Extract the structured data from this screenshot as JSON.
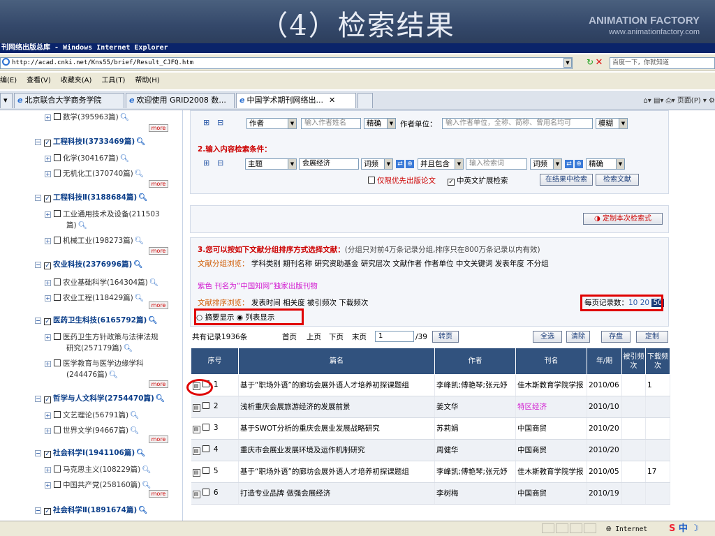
{
  "slide_title": "（4）检索结果",
  "brand": {
    "name": "ANIMATION FACTORY",
    "url": "www.animationfactory.com"
  },
  "window_title": "刊网络出版总库 - Windows Internet Explorer",
  "address": "http://acad.cnki.net/Kns55/brief/Result_CJFQ.htm",
  "search_placeholder": "百度一下，你就知道",
  "menu": [
    "编(E)",
    "查看(V)",
    "收藏夹(A)",
    "工具(T)",
    "帮助(H)"
  ],
  "tabs": [
    "北京联合大学商务学院",
    "欢迎使用 GRID2008 数...",
    "中国学术期刊网络出..."
  ],
  "tab_tools": "页面(P)",
  "sidebar": {
    "items": [
      {
        "text": "数学(395963篇)",
        "level": "sub"
      },
      {
        "text": "工程科技Ⅰ(3733469篇)",
        "level": "top"
      },
      {
        "text": "化学(304167篇)",
        "level": "sub"
      },
      {
        "text": "无机化工(370740篇)",
        "level": "sub"
      },
      {
        "text": "工程科技Ⅱ(3188684篇)",
        "level": "top"
      },
      {
        "text": "工业通用技术及设备(211503",
        "level": "sub"
      },
      {
        "text": "篇)",
        "level": "cont"
      },
      {
        "text": "机械工业(198273篇)",
        "level": "sub"
      },
      {
        "text": "农业科技(2376996篇)",
        "level": "top"
      },
      {
        "text": "农业基础科学(164304篇)",
        "level": "sub"
      },
      {
        "text": "农业工程(118429篇)",
        "level": "sub"
      },
      {
        "text": "医药卫生科技(6165792篇)",
        "level": "top"
      },
      {
        "text": "医药卫生方针政策与法律法规",
        "level": "sub"
      },
      {
        "text": "研究(257179篇)",
        "level": "cont"
      },
      {
        "text": "医学教育与医学边缘学科",
        "level": "sub"
      },
      {
        "text": "(244476篇)",
        "level": "cont"
      },
      {
        "text": "哲学与人文科学(2754470篇)",
        "level": "top"
      },
      {
        "text": "文艺理论(56791篇)",
        "level": "sub"
      },
      {
        "text": "世界文学(94667篇)",
        "level": "sub"
      },
      {
        "text": "社会科学Ⅰ(1941106篇)",
        "level": "top"
      },
      {
        "text": "马克思主义(108229篇)",
        "level": "sub"
      },
      {
        "text": "中国共产党(258160篇)",
        "level": "sub"
      },
      {
        "text": "社会科学Ⅱ(1891674篇)",
        "level": "top"
      }
    ],
    "more_label": "more"
  },
  "search": {
    "field1": "作者",
    "field1_placeholder": "输入作者姓名",
    "match1": "精确",
    "author_unit_label": "作者单位：",
    "author_unit_placeholder": "输入作者单位，全称、简称、曾用名均可",
    "match_fuzzy": "模糊",
    "section2_title": "2.输入内容检索条件：",
    "field2": "主题",
    "keyword": "会展经济",
    "freq1": "词频",
    "logic": "并且包含",
    "keyword2_placeholder": "输入检索词",
    "freq2": "词频",
    "match2": "精确",
    "option_online_first": "仅限优先出版论文",
    "option_expand": "中英文扩展检索",
    "btn_search_in_results": "在结果中检索",
    "btn_search": "检索文献",
    "btn_custom": "定制本次检索式"
  },
  "grouping": {
    "title": "3.您可以按如下文献分组排序方式选择文献：",
    "note": "(分组只对前4万条记录分组,排序只在800万条记录以内有效)",
    "browse_label": "文献分组浏览：",
    "groups": [
      "学科类别",
      "期刊名称",
      "研究资助基金",
      "研究层次",
      "文献作者",
      "作者单位",
      "中文关键词",
      "发表年度",
      "不分组"
    ],
    "pink_note": "紫色 刊名为“中国知网”独家出版刊物",
    "sort_label": "文献排序浏览：",
    "sorts": [
      "发表时间",
      "相关度",
      "被引频次",
      "下载频次"
    ],
    "per_page_label": "每页记录数：",
    "per_page": [
      "10",
      "20",
      "50"
    ],
    "display_abstract": "摘要显示",
    "display_list": "列表显示"
  },
  "pager": {
    "total": "共有记录1936条",
    "first": "首页",
    "prev": "上页",
    "next": "下页",
    "last": "末页",
    "page": "1",
    "pages": "/39",
    "go": "转页",
    "select_all": "全选",
    "clear": "清除",
    "save": "存盘",
    "custom": "定制"
  },
  "table": {
    "headers": [
      "序号",
      "篇名",
      "作者",
      "刊名",
      "年/期",
      "被引频次",
      "下载频次"
    ],
    "rows": [
      {
        "no": "1",
        "title": "基于“职场外语”的廊坊会展外语人才培养初探课题组",
        "author": "李峰凯;傅艳琴;张元妤",
        "journal": "佳木斯教育学院学报",
        "issue": "2010/06",
        "cited": "",
        "downloads": "1"
      },
      {
        "no": "2",
        "title": "浅析重庆会展旅游经济的发展前景",
        "author": "姜文华",
        "journal": "特区经济",
        "issue": "2010/10",
        "cited": "",
        "downloads": ""
      },
      {
        "no": "3",
        "title": "基于SWOT分析的重庆会展业发展战略研究",
        "author": "苏莉娟",
        "journal": "中国商贸",
        "issue": "2010/20",
        "cited": "",
        "downloads": ""
      },
      {
        "no": "4",
        "title": "重庆市会展业发展环境及运作机制研究",
        "author": "周健华",
        "journal": "中国商贸",
        "issue": "2010/20",
        "cited": "",
        "downloads": ""
      },
      {
        "no": "5",
        "title": "基于“职场外语”的廊坊会展外语人才培养初探课题组",
        "author": "李峰凯;傅艳琴;张元妤",
        "journal": "佳木斯教育学院学报",
        "issue": "2010/05",
        "cited": "",
        "downloads": "17"
      },
      {
        "no": "6",
        "title": "打造专业品牌 做强会展经济",
        "author": "李树梅",
        "journal": "中国商贸",
        "issue": "2010/19",
        "cited": "",
        "downloads": ""
      }
    ]
  },
  "status": {
    "zone": "Internet",
    "ime": "中"
  }
}
